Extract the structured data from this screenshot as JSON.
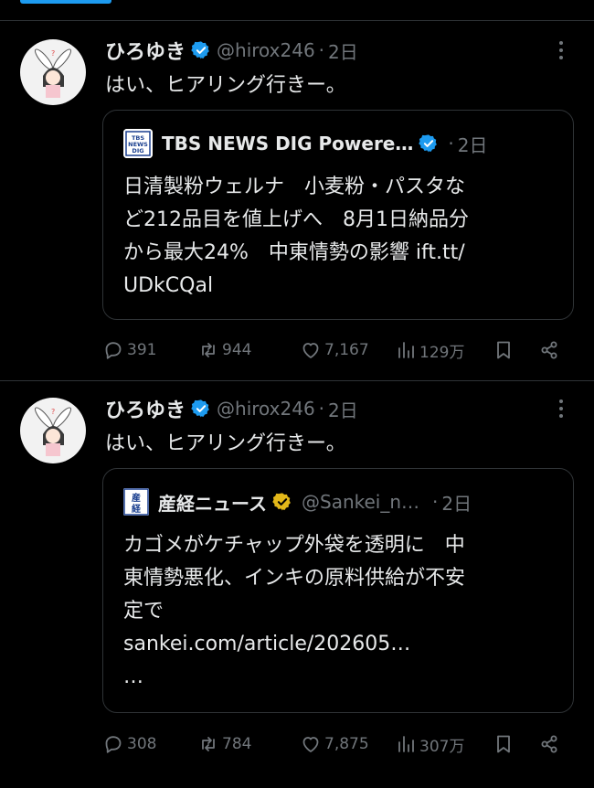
{
  "posts": [
    {
      "author": "ひろゆき",
      "handle": "@hirox246",
      "separator": "·",
      "time": "2日",
      "text": "はい、ヒアリング行きー。",
      "quote": {
        "source_name": "TBS NEWS DIG Powere…",
        "logo_lines": [
          "TBS",
          "NEWS",
          "DIG"
        ],
        "separator": "·",
        "time": "2日",
        "lines": [
          "日清製粉ウェルナ　小麦粉・パスタな",
          "ど212品目を値上げへ　8月1日納品分",
          "から最大24%　中東情勢の影響 ift.tt/",
          "UDkCQal"
        ]
      },
      "stats": {
        "replies": "391",
        "reposts": "944",
        "likes": "7,167",
        "views": "129万"
      }
    },
    {
      "author": "ひろゆき",
      "handle": "@hirox246",
      "separator": "·",
      "time": "2日",
      "text": "はい、ヒアリング行きー。",
      "quote": {
        "source_name": "産経ニュース",
        "source_handle": "@Sankei_n…",
        "logo_lines": [
          "産",
          "経"
        ],
        "separator": "·",
        "time": "2日",
        "lines": [
          "カゴメがケチャップ外袋を透明に　中",
          "東情勢悪化、インキの原料供給が不安",
          "定で",
          "sankei.com/article/202605…",
          "…"
        ]
      },
      "stats": {
        "replies": "308",
        "reposts": "784",
        "likes": "7,875",
        "views": "307万"
      }
    }
  ],
  "colors": {
    "background": "#000000",
    "text": "#e7e9ea",
    "muted": "#71767b",
    "verified_blue": "#1d9bf0",
    "verified_gold": "#e2b719",
    "border": "#2f3336"
  }
}
